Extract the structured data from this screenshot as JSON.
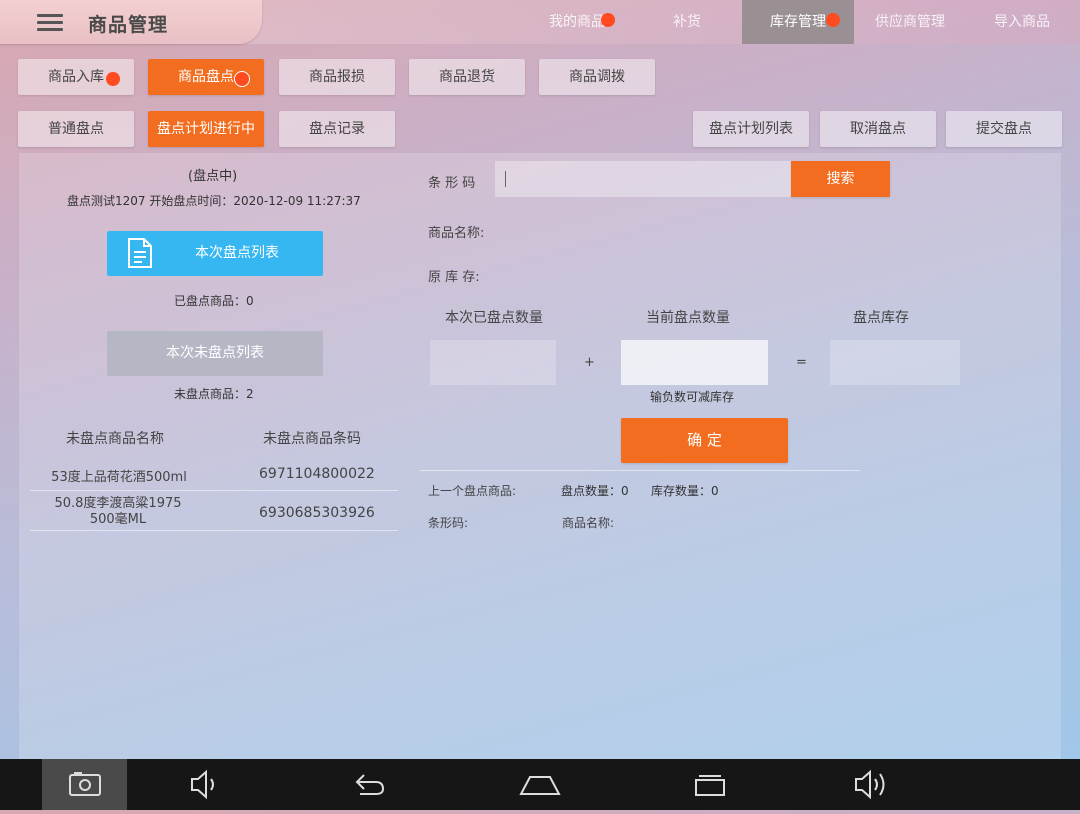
{
  "header": {
    "title": "商品管理",
    "nav": [
      {
        "label": "我的商品",
        "badge": true,
        "active": false
      },
      {
        "label": "补货",
        "badge": false,
        "active": false
      },
      {
        "label": "库存管理",
        "badge": true,
        "active": true
      },
      {
        "label": "供应商管理",
        "badge": false,
        "active": false
      },
      {
        "label": "导入商品",
        "badge": false,
        "active": false
      }
    ]
  },
  "tabs_row1": [
    "商品入库",
    "商品盘点",
    "商品报损",
    "商品退货",
    "商品调拨"
  ],
  "tabs_row2": [
    "普通盘点",
    "盘点计划进行中",
    "盘点记录"
  ],
  "actions": [
    "盘点计划列表",
    "取消盘点",
    "提交盘点"
  ],
  "left": {
    "status": "(盘点中)",
    "plan_info": "盘点测试1207 开始盘点时间：2020-12-09 11:27:37",
    "counted_list_btn": "本次盘点列表",
    "counted_text": "已盘点商品：0",
    "uncounted_list_btn": "本次未盘点列表",
    "uncounted_text": "未盘点商品：2",
    "table": {
      "headers": [
        "未盘点商品名称",
        "未盘点商品条码"
      ],
      "rows": [
        {
          "name": "53度上品荷花酒500ml",
          "barcode": "6971104800022"
        },
        {
          "name": "50.8度李渡高粱1975\n500毫ML",
          "barcode": "6930685303926"
        }
      ]
    }
  },
  "right": {
    "barcode_label": "条 形 码",
    "barcode_value": "",
    "search_btn": "搜索",
    "product_name_label": "商品名称:",
    "original_stock_label": "原 库 存:",
    "col_counted": "本次已盘点数量",
    "col_current": "当前盘点数量",
    "col_stock": "盘点库存",
    "plus": "+",
    "equals": "=",
    "hint": "输负数可减库存",
    "confirm_btn": "确 定",
    "last_item_label": "上一个盘点商品:",
    "last_count": "盘点数量：0",
    "last_stock": "库存数量：0",
    "last_barcode_label": "条形码:",
    "last_name_label": "商品名称:"
  },
  "colors": {
    "accent": "#f26d1f",
    "blue": "#36b7f1",
    "badge": "#ff4b1f"
  },
  "system_bar": [
    "screenshot-icon",
    "volume-down-icon",
    "back-icon",
    "home-icon",
    "recents-icon",
    "volume-up-icon"
  ]
}
